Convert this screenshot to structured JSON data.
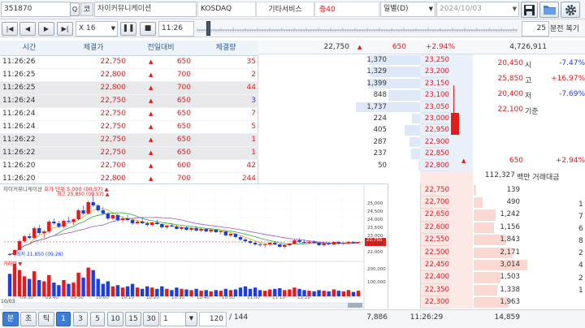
{
  "toolbar": {
    "code": "351870",
    "search_icon": "search-icon",
    "type_label": "코",
    "name": "차이커뮤니케이션",
    "market": "KOSDAQ",
    "sector": "기타서비스",
    "margin": "증40",
    "period": "일별(D)",
    "date": "2024/10/03"
  },
  "playback": {
    "speed": "X 16",
    "time": "11:26",
    "interval": "25",
    "interval_unit": "분전 복기"
  },
  "trades": {
    "headers": [
      "시간",
      "체결가",
      "전일대비",
      "체결량"
    ],
    "rows": [
      {
        "time": "11:26:26",
        "price": "22,750",
        "change": "650",
        "volume": "35",
        "vcolor": "red",
        "hl": false
      },
      {
        "time": "11:26:25",
        "price": "22,800",
        "change": "700",
        "volume": "2",
        "vcolor": "red",
        "hl": false
      },
      {
        "time": "11:26:25",
        "price": "22,800",
        "change": "700",
        "volume": "44",
        "vcolor": "red",
        "hl": true
      },
      {
        "time": "11:26:24",
        "price": "22,750",
        "change": "650",
        "volume": "3",
        "vcolor": "blue",
        "hl": true
      },
      {
        "time": "11:26:24",
        "price": "22,750",
        "change": "650",
        "volume": "7",
        "vcolor": "red",
        "hl": false
      },
      {
        "time": "11:26:24",
        "price": "22,750",
        "change": "650",
        "volume": "5",
        "vcolor": "red",
        "hl": false
      },
      {
        "time": "11:26:22",
        "price": "22,750",
        "change": "650",
        "volume": "1",
        "vcolor": "red",
        "hl": true
      },
      {
        "time": "11:26:22",
        "price": "22,750",
        "change": "650",
        "volume": "1",
        "vcolor": "red",
        "hl": true
      },
      {
        "time": "11:26:20",
        "price": "22,700",
        "change": "600",
        "volume": "42",
        "vcolor": "red",
        "hl": false
      },
      {
        "time": "11:26:20",
        "price": "22,800",
        "change": "700",
        "volume": "244",
        "vcolor": "red",
        "hl": false
      }
    ]
  },
  "summary": {
    "price": "22,750",
    "change": "650",
    "rate": "+2.94%",
    "volume": "4,726,911"
  },
  "asks": [
    {
      "qty": "1,370",
      "price": "23,250",
      "bar": 0.57
    },
    {
      "qty": "1,329",
      "price": "23,200",
      "bar": 0.55
    },
    {
      "qty": "1,399",
      "price": "23,150",
      "bar": 0.58
    },
    {
      "qty": "848",
      "price": "23,100",
      "bar": 0.35
    },
    {
      "qty": "1,737",
      "price": "23,050",
      "bar": 0.72
    },
    {
      "qty": "224",
      "price": "23,000",
      "bar": 0.09
    },
    {
      "qty": "405",
      "price": "22,950",
      "bar": 0.17
    },
    {
      "qty": "287",
      "price": "22,900",
      "bar": 0.12
    },
    {
      "qty": "237",
      "price": "22,850",
      "bar": 0.1
    },
    {
      "qty": "50",
      "price": "22,800",
      "bar": 0.02
    }
  ],
  "bids": [
    {
      "price": "22,750",
      "qty": "139",
      "bar": 0.05
    },
    {
      "price": "22,700",
      "qty": "490",
      "bar": 0.16
    },
    {
      "price": "22,650",
      "qty": "1,242",
      "bar": 0.41
    },
    {
      "price": "22,600",
      "qty": "1,156",
      "bar": 0.38
    },
    {
      "price": "22,550",
      "qty": "1,843",
      "bar": 0.61
    },
    {
      "price": "22,500",
      "qty": "2,171",
      "bar": 0.72
    },
    {
      "price": "22,450",
      "qty": "3,014",
      "bar": 1.0
    },
    {
      "price": "22,400",
      "qty": "1,503",
      "bar": 0.5
    },
    {
      "price": "22,350",
      "qty": "1,338",
      "bar": 0.44
    },
    {
      "price": "22,300",
      "qty": "1,963",
      "bar": 0.65
    }
  ],
  "info": {
    "rows": [
      {
        "value": "20,450",
        "label": "시",
        "pct": "-7.47%",
        "pcolor": "blue"
      },
      {
        "value": "25,850",
        "label": "고",
        "pct": "+16.97%",
        "pcolor": "red"
      },
      {
        "value": "20,400",
        "label": "저",
        "pct": "-7.69%",
        "pcolor": "blue"
      },
      {
        "value": "22,100",
        "label": "기준",
        "pct": "",
        "pcolor": "red"
      }
    ],
    "change": "650",
    "rate": "+2.94%",
    "amount": "112,327",
    "amount_unit": "백만 거래대금"
  },
  "right_edge": [
    "1",
    "7",
    "6",
    "8",
    "2",
    "4",
    "2",
    "1"
  ],
  "chart": {
    "title": "차이커뮤니케이션",
    "header_tags": "호가 단위 5,000 (00:57) ▲",
    "high_label": "최고 25,850 (09:57) ▲",
    "low_label": "최저 21,850 (09:26)",
    "vol_label": "거래량 ▼",
    "price_ticks": [
      "25,000",
      "24,500",
      "24,000",
      "23,500",
      "23,000",
      "22,500",
      "22,000"
    ],
    "cur_price_tag": "22,750",
    "vol_ticks": [
      "200,000",
      "100,000"
    ],
    "time_ticks": [
      "09:30",
      "09:40",
      "09:50",
      "10:00",
      "10:10",
      "10:20",
      "10:30",
      "10:40",
      "10:50",
      "11:00",
      "11:10",
      "11:20"
    ],
    "date_label": "10/03"
  },
  "bottom": {
    "tabs": [
      "분",
      "초",
      "틱"
    ],
    "intervals": [
      "1",
      "3",
      "5",
      "10",
      "15",
      "30"
    ],
    "custom_interval": "1",
    "page": "120",
    "page_total": "/ 144",
    "ask_total": "7,886",
    "time": "11:26:29",
    "bid_total": "14,859"
  },
  "colors": {
    "up": "#e21b1b",
    "down": "#1b3fe2",
    "accent": "#3a7ed8"
  },
  "chart_data": {
    "type": "candlestick",
    "candles": [
      [
        22000,
        22100,
        21900,
        21950
      ],
      [
        21950,
        22300,
        21850,
        22250
      ],
      [
        22250,
        22900,
        22200,
        22800
      ],
      [
        22800,
        23200,
        22700,
        23100
      ],
      [
        23100,
        23300,
        22900,
        23000
      ],
      [
        23000,
        23700,
        22950,
        23600
      ],
      [
        23600,
        23800,
        23200,
        23300
      ],
      [
        23300,
        23500,
        23000,
        23400
      ],
      [
        23400,
        24100,
        23300,
        24000
      ],
      [
        24000,
        24200,
        23800,
        23900
      ],
      [
        23900,
        24050,
        23600,
        23700
      ],
      [
        23700,
        24100,
        23600,
        24050
      ],
      [
        24050,
        24300,
        23900,
        24000
      ],
      [
        24000,
        24200,
        23800,
        24150
      ],
      [
        24150,
        24800,
        24100,
        24700
      ],
      [
        24700,
        25000,
        24400,
        24500
      ],
      [
        24500,
        25300,
        24450,
        25200
      ],
      [
        25200,
        25850,
        24900,
        25000
      ],
      [
        25000,
        25100,
        24600,
        24700
      ],
      [
        24700,
        24900,
        24400,
        24500
      ],
      [
        24500,
        24600,
        24100,
        24200
      ],
      [
        24200,
        24500,
        24100,
        24400
      ],
      [
        24400,
        24500,
        24000,
        24100
      ],
      [
        24100,
        24300,
        23900,
        24200
      ],
      [
        24200,
        24400,
        24000,
        24100
      ],
      [
        24100,
        24200,
        23800,
        23900
      ],
      [
        23900,
        24100,
        23800,
        24000
      ],
      [
        24000,
        24200,
        23850,
        23900
      ],
      [
        23900,
        24000,
        23700,
        23800
      ],
      [
        23800,
        24000,
        23700,
        23950
      ],
      [
        23950,
        24100,
        23800,
        23850
      ],
      [
        23850,
        23900,
        23600,
        23650
      ],
      [
        23650,
        23800,
        23550,
        23750
      ],
      [
        23750,
        23900,
        23650,
        23700
      ],
      [
        23700,
        23800,
        23500,
        23550
      ],
      [
        23550,
        23700,
        23450,
        23650
      ],
      [
        23650,
        23700,
        23450,
        23500
      ],
      [
        23500,
        23650,
        23400,
        23600
      ],
      [
        23600,
        23700,
        23400,
        23450
      ],
      [
        23450,
        23600,
        23350,
        23550
      ],
      [
        23550,
        23600,
        23350,
        23400
      ],
      [
        23400,
        23550,
        23300,
        23500
      ],
      [
        23500,
        23550,
        23300,
        23350
      ],
      [
        23350,
        23450,
        23200,
        23400
      ],
      [
        23400,
        23450,
        23100,
        23150
      ],
      [
        23150,
        23300,
        23050,
        23250
      ],
      [
        23250,
        23300,
        23000,
        23050
      ],
      [
        23050,
        23150,
        22800,
        22900
      ],
      [
        22900,
        23000,
        22700,
        22800
      ],
      [
        22800,
        22900,
        22600,
        22700
      ],
      [
        22700,
        22800,
        22500,
        22600
      ],
      [
        22600,
        22700,
        22450,
        22550
      ],
      [
        22550,
        22650,
        22400,
        22600
      ],
      [
        22600,
        22750,
        22500,
        22700
      ],
      [
        22700,
        22800,
        22550,
        22600
      ],
      [
        22600,
        22650,
        22400,
        22450
      ],
      [
        22450,
        22600,
        22350,
        22550
      ],
      [
        22550,
        22700,
        22500,
        22650
      ],
      [
        22650,
        22900,
        22600,
        22850
      ],
      [
        22850,
        23000,
        22700,
        22750
      ],
      [
        22750,
        22900,
        22650,
        22700
      ],
      [
        22700,
        22800,
        22600,
        22750
      ],
      [
        22750,
        22850,
        22650,
        22700
      ],
      [
        22700,
        22750,
        22500,
        22550
      ],
      [
        22550,
        22700,
        22500,
        22650
      ],
      [
        22650,
        22750,
        22550,
        22600
      ],
      [
        22600,
        22800,
        22550,
        22750
      ],
      [
        22750,
        22800,
        22600,
        22650
      ],
      [
        22650,
        22750,
        22550,
        22700
      ],
      [
        22700,
        22800,
        22600,
        22750
      ],
      [
        22750,
        22800,
        22650,
        22700
      ],
      [
        22700,
        22750,
        22600,
        22750
      ]
    ],
    "volumes": [
      180,
      260,
      210,
      160,
      140,
      200,
      130,
      120,
      170,
      110,
      90,
      130,
      100,
      110,
      190,
      150,
      230,
      210,
      140,
      100,
      120,
      80,
      90,
      70,
      80,
      100,
      70,
      60,
      80,
      70,
      60,
      80,
      60,
      50,
      70,
      60,
      55,
      50,
      60,
      45,
      50,
      40,
      50,
      45,
      60,
      50,
      55,
      70,
      80,
      60,
      70,
      50,
      45,
      55,
      60,
      65,
      50,
      55,
      70,
      60,
      50,
      45,
      40,
      50,
      45,
      40,
      55,
      45,
      40,
      50,
      35,
      45
    ],
    "price_range": [
      21800,
      25900
    ],
    "volume_range": [
      0,
      260000
    ]
  }
}
